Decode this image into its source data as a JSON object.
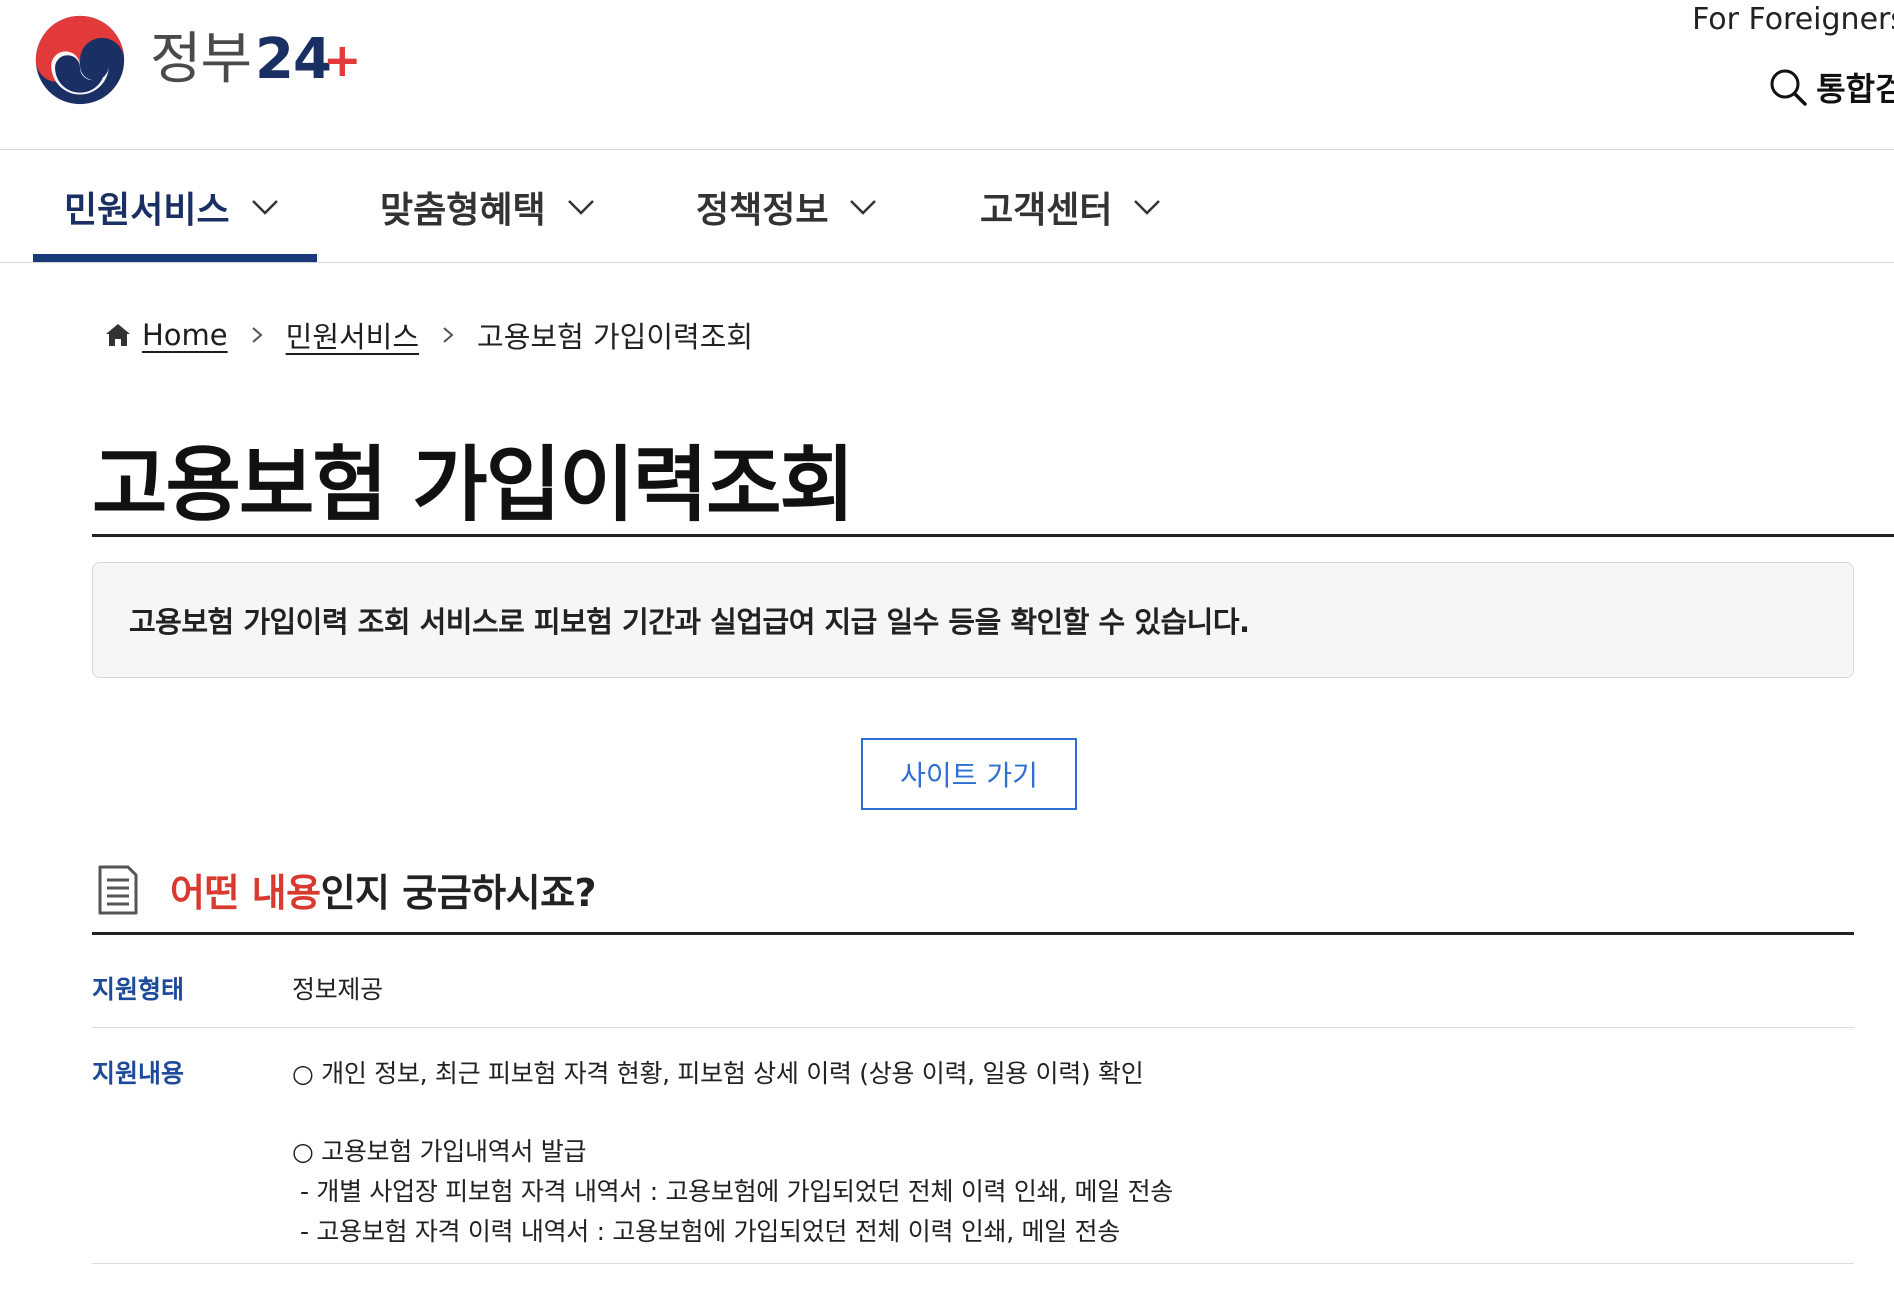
{
  "header": {
    "logo_text": "정부",
    "logo_number": "24",
    "logo_plus": "+",
    "for_foreigners": "For Foreigners",
    "search_label": "통합검색"
  },
  "nav": {
    "items": [
      {
        "label": "민원서비스",
        "active": true
      },
      {
        "label": "맞춤형혜택",
        "active": false
      },
      {
        "label": "정책정보",
        "active": false
      },
      {
        "label": "고객센터",
        "active": false
      }
    ]
  },
  "breadcrumb": {
    "home": "Home",
    "level1": "민원서비스",
    "current": "고용보험 가입이력조회"
  },
  "page": {
    "title": "고용보험 가입이력조회",
    "summary": "고용보험 가입이력 조회 서비스로 피보험 기간과 실업급여 지급 일수 등을 확인할 수 있습니다.",
    "site_button": "사이트 가기"
  },
  "section": {
    "title_accent": "어떤 내용",
    "title_rest": "인지 궁금하시죠?"
  },
  "info": {
    "support_type_label": "지원형태",
    "support_type_value": "정보제공",
    "support_content_label": "지원내용",
    "support_content_lines": [
      "○ 개인 정보, 최근 피보험 자격 현황, 피보험 상세 이력 (상용 이력, 일용 이력) 확인",
      "○ 고용보험 가입내역서 발급",
      "- 개별 사업장 피보험 자격 내역서 : 고용보험에 가입되었던 전체 이력 인쇄, 메일 전송",
      "- 고용보험 자격 이력 내역서 : 고용보험에 가입되었던 전체 이력 인쇄, 메일 전송"
    ]
  },
  "colors": {
    "brand_navy": "#1a2f63",
    "accent_red": "#d93a2f",
    "link_blue": "#2f6fd1",
    "label_blue": "#1d4a9a"
  }
}
